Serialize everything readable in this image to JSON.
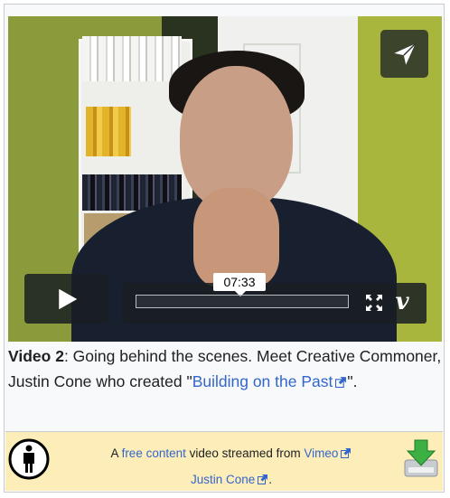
{
  "player": {
    "time_tooltip": "07:33",
    "progress_fraction": 0.0
  },
  "caption": {
    "label": "Video 2",
    "text_1": ": Going behind the scenes. Meet Creative Commoner, Justin Cone who created \"",
    "link": "Building on the Past",
    "text_2": "\"."
  },
  "footer": {
    "prefix": "A ",
    "free_content_link": "free content",
    "middle": " video streamed from ",
    "vimeo_link": "Vimeo",
    "author_link": "Justin Cone",
    "suffix": "."
  },
  "icons": {
    "send": "paper-plane-icon",
    "play": "play-icon",
    "fullscreen": "fullscreen-icon",
    "vimeo": "vimeo-logo-icon",
    "accessibility": "accessibility-icon",
    "download": "download-icon",
    "external": "external-link-icon"
  },
  "colors": {
    "link": "#3366cc",
    "footer_bg": "#fdeeb9",
    "controls_bg": "#191e22"
  }
}
